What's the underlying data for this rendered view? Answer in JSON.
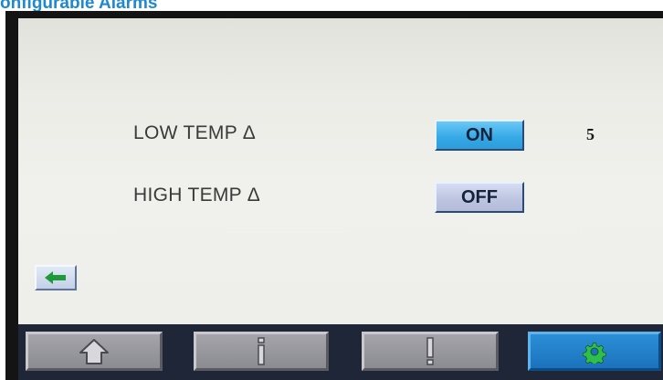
{
  "doc_title": "onfigurable Alarms",
  "rows": [
    {
      "label": "LOW TEMP Δ",
      "state": "ON",
      "value": "5"
    },
    {
      "label": "HIGH TEMP Δ",
      "state": "OFF"
    }
  ],
  "back_button": {
    "icon": "left-arrow-icon"
  },
  "nav": {
    "items": [
      {
        "name": "home",
        "icon": "house-icon",
        "selected": false
      },
      {
        "name": "info",
        "icon": "info-icon",
        "selected": false
      },
      {
        "name": "alerts",
        "icon": "exclamation-icon",
        "selected": false
      },
      {
        "name": "settings",
        "icon": "gear-icon",
        "selected": true
      }
    ]
  },
  "colors": {
    "title": "#1e88d0",
    "on_button": "#34a8e6",
    "off_button": "#bcc4e0",
    "nav_selected": "#1b72bd",
    "nav_unselected": "#8b8b92",
    "back_arrow": "#1f9a3a",
    "gear": "#2fbf4b"
  }
}
